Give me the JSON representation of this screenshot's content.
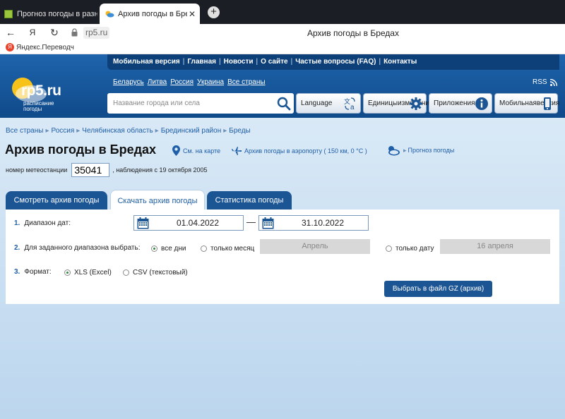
{
  "browser": {
    "tabs": [
      {
        "title": "Прогноз погоды в разны"
      },
      {
        "title": "Архив погоды в Бредах",
        "close": "✕"
      }
    ],
    "new_tab": "+",
    "url": "rp5.ru",
    "page_title": "Архив погоды в Бредах",
    "bookmark": "Яндекс.Переводч",
    "bookmark_icon": "Я",
    "yandex_btn": "Я"
  },
  "site": {
    "topnav": [
      "Мобильная версия",
      "Главная",
      "Новости",
      "О сайте",
      "Частые вопросы (FAQ)",
      "Контакты"
    ],
    "logo_text": "rp5.ru",
    "logo_sub1": "расписание",
    "logo_sub2": "погоды",
    "countries": [
      "Беларусь",
      "Литва",
      "Россия",
      "Украина",
      "Все страны"
    ],
    "rss": "RSS",
    "search_placeholder": "Название города или села",
    "buttons": {
      "language": "Language",
      "units1": "Единицы",
      "units2": "измерений",
      "apps": "Приложения",
      "mobile1": "Мобильная",
      "mobile2": "версия"
    }
  },
  "breadcrumb": [
    "Все страны",
    "Россия",
    "Челябинская область",
    "Брединский район",
    "Бреды"
  ],
  "page": {
    "title": "Архив погоды в Бредах",
    "map_link": "См. на карте",
    "airport_link": "Архив погоды в аэропорту ( 150 км, 0 °С )",
    "forecast_link": "Прогноз погоды",
    "station_label": "номер метеостанции",
    "station_number": "35041",
    "observations": ", наблюдения с 19 октября 2005"
  },
  "tabs": [
    "Смотреть архив погоды",
    "Скачать архив погоды",
    "Статистика погоды"
  ],
  "form": {
    "row1_num": "1.",
    "row1_label": "Диапазон дат:",
    "date_from": "01.04.2022",
    "dash": "—",
    "date_to": "31.10.2022",
    "row2_num": "2.",
    "row2_label": "Для заданного диапазона выбрать:",
    "opt_all_days": "все дни",
    "opt_only_month": "только месяц",
    "month_value": "Апрель",
    "opt_only_date": "только дату",
    "date_value": "16 апреля",
    "row3_num": "3.",
    "row3_label": "Формат:",
    "fmt_xls": "XLS (Excel)",
    "fmt_csv": "CSV (текстовый)",
    "submit": "Выбрать в файл GZ (архив)"
  },
  "colors": {
    "header_blue": "#1f64ac",
    "nav_dark": "#0d3f78",
    "tab_dark": "#1c5594",
    "link": "#1f5fa8",
    "radio_green": "#2a8a3e"
  }
}
